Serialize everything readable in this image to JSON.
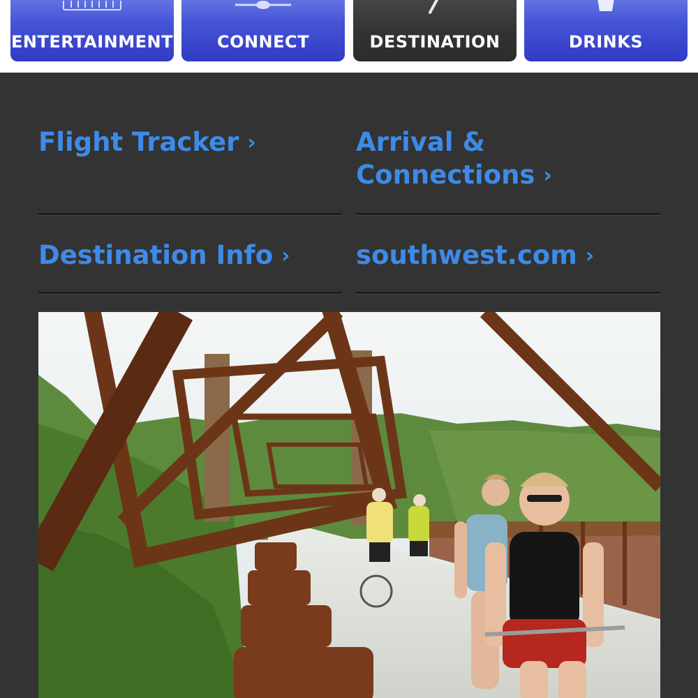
{
  "tabs": [
    {
      "label": "ENTERTAINMENT",
      "icon": "keyboard-icon",
      "active": false
    },
    {
      "label": "CONNECT",
      "icon": "airplane-icon",
      "active": false
    },
    {
      "label": "DESTINATION",
      "icon": "pen-icon",
      "active": true
    },
    {
      "label": "DRINKS",
      "icon": "cup-icon",
      "active": false
    }
  ],
  "links": [
    {
      "line1": "Flight Tracker",
      "line2": ""
    },
    {
      "line1": "Arrival &",
      "line2": "Connections"
    },
    {
      "line1": "Destination Info",
      "line2": ""
    },
    {
      "line1": "southwest.com",
      "line2": ""
    }
  ],
  "chevron": "›",
  "photo": {
    "subject": "cyclists-on-bridge-photo"
  },
  "colors": {
    "tab_blue": "#4654d6",
    "tab_active": "#333333",
    "link": "#3d8be8",
    "panel": "#333333"
  }
}
